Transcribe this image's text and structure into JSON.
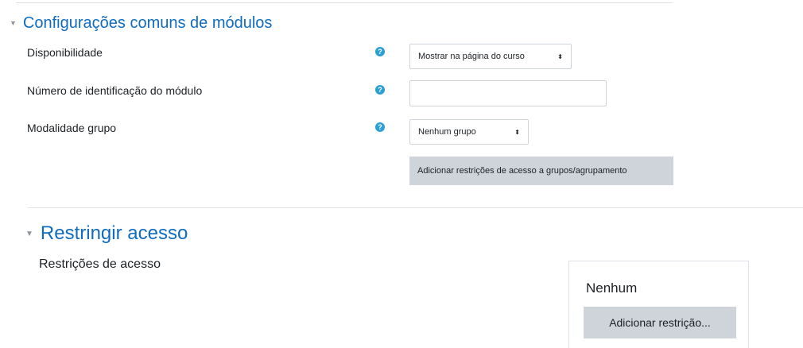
{
  "common": {
    "title": "Configurações comuns de módulos",
    "fields": [
      {
        "label": "Disponibilidade",
        "value": "Mostrar na página do curso"
      },
      {
        "label": "Número de identificação do módulo",
        "value": ""
      },
      {
        "label": "Modalidade grupo",
        "value": "Nenhum grupo"
      }
    ],
    "help_glyph": "?",
    "group_restrict_button": "Adicionar restrições de acesso a grupos/agrupamento"
  },
  "restrict": {
    "title": "Restringir acesso",
    "label": "Restrições de acesso",
    "none_text": "Nenhum",
    "add_button": "Adicionar restrição..."
  },
  "icons": {
    "collapse": "caret-down-icon",
    "help": "question-circle-icon",
    "select_arrow": "sort-arrows-icon"
  },
  "colors": {
    "link_blue": "#0f6cbf",
    "help_blue": "#2b9fd6",
    "button_gray": "#ced4da"
  }
}
